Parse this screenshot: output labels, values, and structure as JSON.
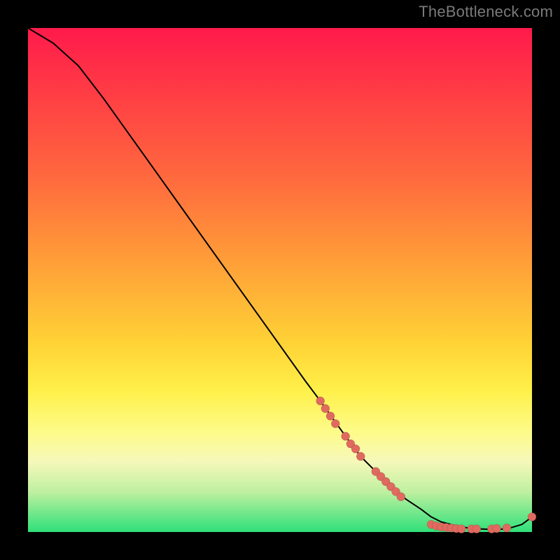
{
  "watermark": "TheBottleneck.com",
  "colors": {
    "background": "#000000",
    "gradient_top": "#ff1a4b",
    "gradient_mid": "#ffd436",
    "gradient_bottom": "#2fe07a",
    "curve": "#000000",
    "dots": "#e06a5f"
  },
  "chart_data": {
    "type": "line",
    "title": "",
    "xlabel": "",
    "ylabel": "",
    "xlim": [
      0,
      100
    ],
    "ylim": [
      0,
      100
    ],
    "series": [
      {
        "name": "curve",
        "x": [
          0,
          5,
          10,
          15,
          20,
          25,
          30,
          35,
          40,
          45,
          50,
          55,
          58,
          63,
          66,
          69,
          72,
          75,
          78,
          80,
          82,
          85,
          88,
          92,
          95,
          98,
          100
        ],
        "y": [
          100,
          97,
          92.5,
          86,
          79,
          72,
          65,
          58,
          51,
          44,
          37,
          30,
          26,
          19,
          15,
          12,
          9,
          6.5,
          4.5,
          3,
          2,
          1.2,
          0.7,
          0.5,
          0.6,
          1.5,
          3
        ]
      }
    ],
    "points": [
      {
        "x": 58,
        "y": 26
      },
      {
        "x": 59,
        "y": 24.5
      },
      {
        "x": 60,
        "y": 23
      },
      {
        "x": 61,
        "y": 21.5
      },
      {
        "x": 63,
        "y": 19
      },
      {
        "x": 64,
        "y": 17.5
      },
      {
        "x": 65,
        "y": 16.5
      },
      {
        "x": 66,
        "y": 15
      },
      {
        "x": 69,
        "y": 12
      },
      {
        "x": 70,
        "y": 11
      },
      {
        "x": 71,
        "y": 10
      },
      {
        "x": 72,
        "y": 9
      },
      {
        "x": 73,
        "y": 8
      },
      {
        "x": 74,
        "y": 7
      },
      {
        "x": 80,
        "y": 1.5
      },
      {
        "x": 81,
        "y": 1.2
      },
      {
        "x": 82,
        "y": 1.0
      },
      {
        "x": 83,
        "y": 0.9
      },
      {
        "x": 84,
        "y": 0.8
      },
      {
        "x": 85,
        "y": 0.7
      },
      {
        "x": 86,
        "y": 0.6
      },
      {
        "x": 88,
        "y": 0.6
      },
      {
        "x": 89,
        "y": 0.6
      },
      {
        "x": 92,
        "y": 0.6
      },
      {
        "x": 93,
        "y": 0.7
      },
      {
        "x": 95,
        "y": 0.8
      },
      {
        "x": 100,
        "y": 3
      }
    ]
  }
}
